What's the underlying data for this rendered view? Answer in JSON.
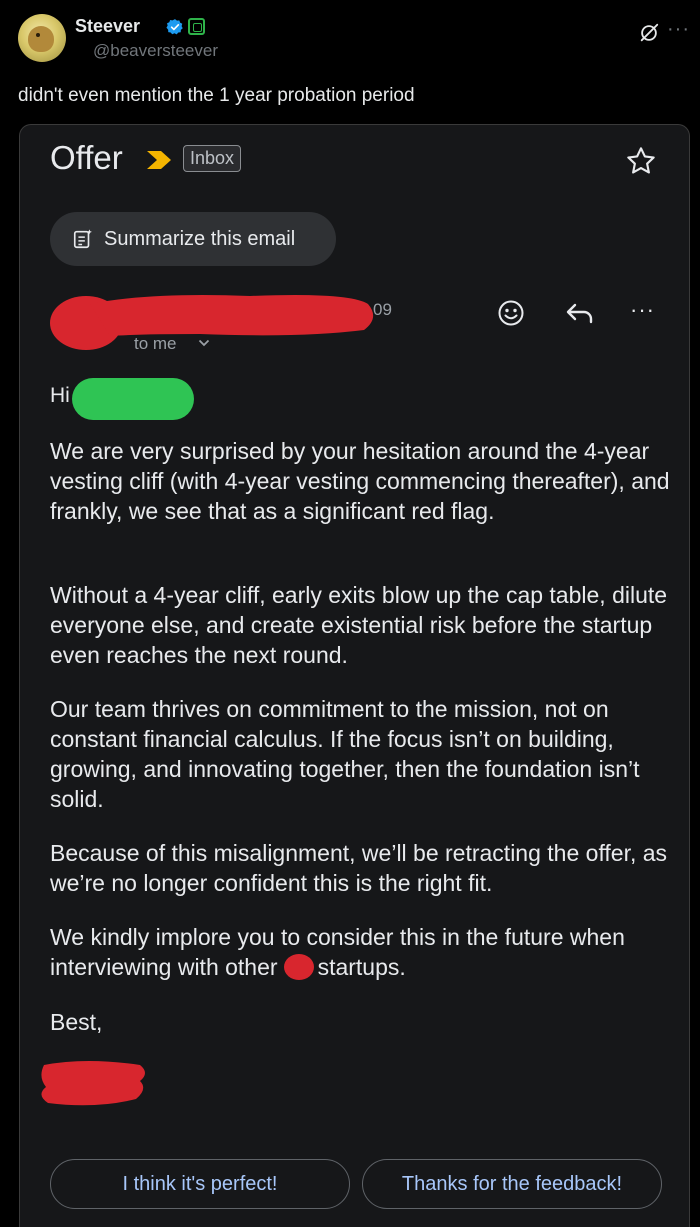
{
  "tweet": {
    "display_name": "Steever",
    "handle": "@beaversteever",
    "text": "didn't even mention the 1 year probation period",
    "more_label": "···"
  },
  "email": {
    "subject": "Offer",
    "label_chip": "Inbox",
    "summarize_label": "Summarize this email",
    "sender_fragment": "09",
    "recipient_label": "to me",
    "greeting": "Hi",
    "paragraphs": [
      "We are very surprised by your hesitation around the 4-year vesting cliff (with 4-year vesting commencing thereafter), and frankly, we see that as a significant red flag.",
      "Without a 4-year cliff, early exits blow up the cap table, dilute everyone else, and create existential risk before the startup even reaches the next round.",
      "Our team thrives on commitment to the mission, not on constant financial calculus. If the focus isn’t on building, growing, and innovating together, then the foundation isn’t solid.",
      "Because of this misalignment, we’ll be retracting the offer, as we’re no longer confident this is the right fit."
    ],
    "p6_before": "We kindly implore you to consider this in the future when interviewing with other",
    "p6_after": "startups.",
    "signoff": "Best,",
    "smart_replies": [
      "I think it's perfect!",
      "Thanks for the feedback!"
    ],
    "kebab_label": "···"
  },
  "colors": {
    "redaction_red": "#d8262e",
    "redaction_green": "#2fc454",
    "verified_blue": "#1d9bf0",
    "importance_yellow": "#f4b400",
    "link_blue": "#a8c7fa"
  },
  "icons": [
    "verified-icon",
    "affiliate-badge-icon",
    "grok-icon",
    "more-icon",
    "importance-marker-icon",
    "star-icon",
    "summarize-icon",
    "emoji-reaction-icon",
    "reply-icon",
    "more-options-icon",
    "chevron-down-icon"
  ]
}
